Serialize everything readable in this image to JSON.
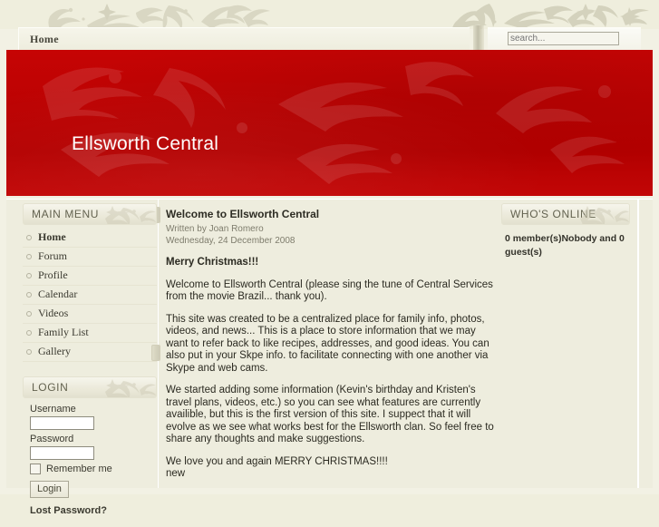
{
  "site": {
    "banner_title": "Ellsworth Central",
    "banner_color": "#bb0202",
    "background_color": "#efeedd"
  },
  "header": {
    "menu_items": [
      "Home"
    ],
    "home_label": "Home",
    "search": {
      "placeholder": "search...",
      "value": ""
    }
  },
  "sidebar_left": {
    "main_menu": {
      "title": "MAIN MENU",
      "items": [
        {
          "label": "Home",
          "active": true
        },
        {
          "label": "Forum",
          "active": false
        },
        {
          "label": "Profile",
          "active": false
        },
        {
          "label": "Calendar",
          "active": false
        },
        {
          "label": "Videos",
          "active": false
        },
        {
          "label": "Family List",
          "active": false
        },
        {
          "label": "Gallery",
          "active": false
        }
      ]
    },
    "login": {
      "title": "LOGIN",
      "username_label": "Username",
      "username_value": "",
      "password_label": "Password",
      "password_value": "",
      "remember_label": "Remember me",
      "remember_checked": false,
      "submit_label": "Login",
      "lost_password_label": "Lost Password?"
    }
  },
  "main": {
    "article": {
      "title": "Welcome to Ellsworth Central",
      "author": "Written by Joan Romero",
      "date": "Wednesday, 24 December 2008",
      "paragraphs": [
        {
          "text": "Merry Christmas!!!",
          "bold": true
        },
        {
          "text": "Welcome to Ellsworth Central (please sing the tune of Central Services from the movie Brazil... thank you).",
          "bold": false
        },
        {
          "text": "This site was created to be a centralized place for family info, photos, videos, and news...  This is  a place to store information that we may want to refer back to like recipes, addresses, and good ideas.  You can also put in your Skpe info. to facilitate connecting with one another via Skype and web cams.",
          "bold": false
        },
        {
          "text": "We started adding some information (Kevin's birthday and Kristen's travel plans, videos, etc.) so you can see what features are currently availible, but this is the first version of this site.  I suppect that it will evolve as we see what works best for the Ellsworth clan.  So feel free to share any thoughts and make suggestions.",
          "bold": false
        },
        {
          "text": "We love you and again MERRY CHRISTMAS!!!!",
          "bold": false
        },
        {
          "text": "new",
          "bold": false
        }
      ]
    }
  },
  "sidebar_right": {
    "whos_online": {
      "title": "WHO'S ONLINE",
      "status": "0 member(s)Nobody and 0 guest(s)"
    }
  }
}
